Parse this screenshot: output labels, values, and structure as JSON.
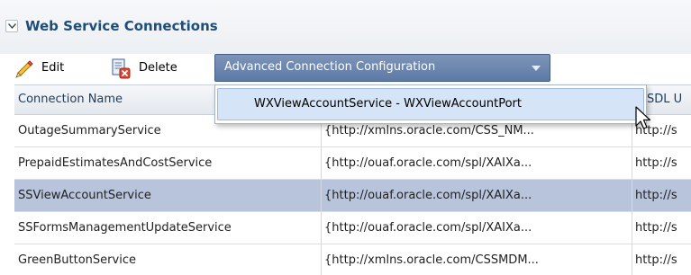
{
  "section": {
    "title": "Web Service Connections"
  },
  "toolbar": {
    "edit_label": "Edit",
    "delete_label": "Delete",
    "advanced_label": "Advanced Connection Configuration"
  },
  "menu": {
    "items": [
      {
        "label": "WXViewAccountService - WXViewAccountPort"
      }
    ]
  },
  "table": {
    "columns": [
      "Connection Name",
      "",
      "SDL U"
    ],
    "rows": [
      {
        "name": "OutageSummaryService",
        "namespace": "{http://xmlns.oracle.com/CSS_NM...",
        "url": "http://s",
        "selected": false
      },
      {
        "name": "PrepaidEstimatesAndCostService",
        "namespace": "{http://ouaf.oracle.com/spl/XAIXa...",
        "url": "http://s",
        "selected": false
      },
      {
        "name": "SSViewAccountService",
        "namespace": "{http://ouaf.oracle.com/spl/XAIXa...",
        "url": "http://s",
        "selected": true
      },
      {
        "name": "SSFormsManagementUpdateService",
        "namespace": "{http://ouaf.oracle.com/spl/XAIXa...",
        "url": "http://s",
        "selected": false
      },
      {
        "name": "GreenButtonService",
        "namespace": "{http://xmlns.oracle.com/CSSMDM...",
        "url": "http://s",
        "selected": false
      }
    ]
  },
  "colors": {
    "accent": "#5c7aa6",
    "selected_row": "#b7c4dc",
    "title": "#1c4e7a"
  }
}
